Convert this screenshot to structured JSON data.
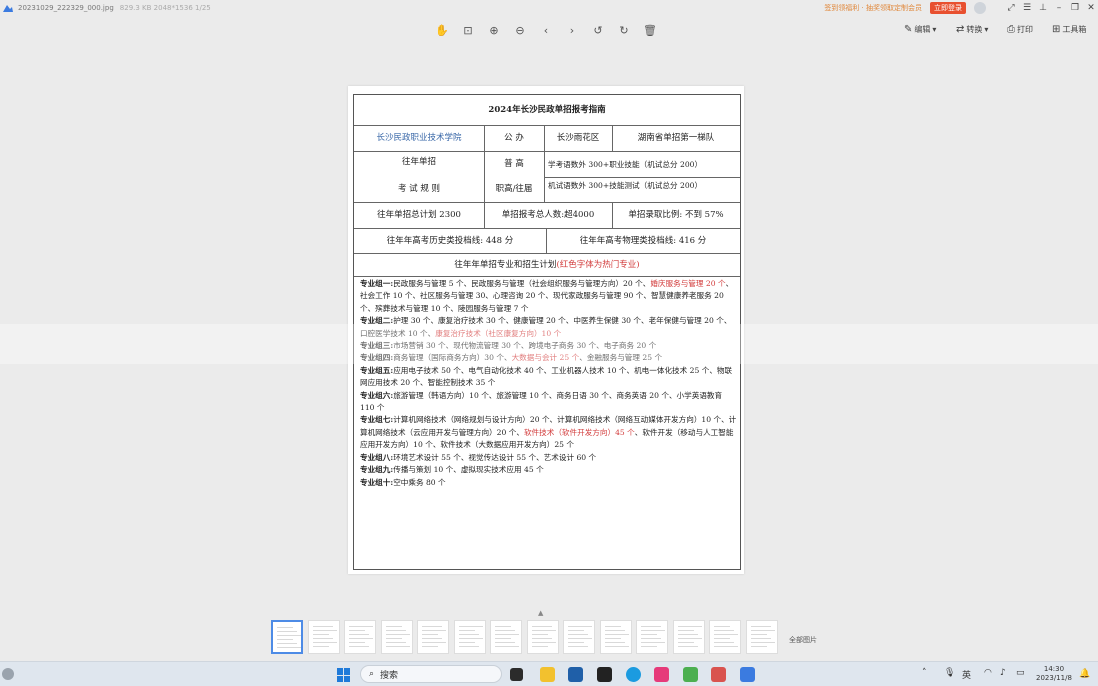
{
  "window": {
    "filename": "20231029_222329_000.jpg",
    "meta": "829.3 KB  2048*1536  1/25",
    "promo": "签到领福利 · 抽奖领取定制会员",
    "login_label": "立即登录"
  },
  "toolbar": {
    "edit_label": "编辑",
    "convert_label": "转换",
    "print_label": "打印",
    "tools_label": "工具箱"
  },
  "doc": {
    "title": "2024年长沙民政单招报考指南",
    "school": "长沙民政职业技术学院",
    "ownership": "公 办",
    "district": "长沙雨花区",
    "tier": "湖南省单招第一梯队",
    "rules_line1": "往年单招",
    "rules_line2": "考 试 规 则",
    "track_general": "普 高",
    "track_general_rule": "学考语数外 300+职业技能（机试总分 200）",
    "track_voc": "职高/往届",
    "track_voc_rule": "机试语数外 300+技能测试（机试总分 200）",
    "plan_total": "往年单招总计划 2300",
    "applicants": "单招报考总人数:超4000",
    "admit_ratio": "单招录取比例: 不到 57%",
    "hist_line": "往年年高考历史类投档线: 448 分",
    "phys_line": "往年年高考物理类投档线: 416 分",
    "plan_header": "往年年单招专业和招生计划",
    "plan_header_note": "(红色字体为热门专业)",
    "groups": [
      {
        "label": "专业组一:",
        "text": "民政服务与管理 5 个、民政服务与管理（社会组织服务与管理方向）20 个、",
        "hot": "婚庆服务与管理 20 个",
        "tail": "、社会工作 10 个、社区服务与管理 30、心理咨询 20 个、现代家政服务与管理 90 个、智慧健康养老服务 20 个、殡葬技术与管理 10 个、陵园服务与管理 7 个"
      },
      {
        "label": "专业组二:",
        "text": "护理 30 个、康复治疗技术 30 个、健康管理 20 个、中医养生保健 30 个、老年保健与管理 20 个、口腔医学技术 10 个、",
        "hot": "康复治疗技术（社区康复方向）10 个",
        "tail": ""
      },
      {
        "label": "专业组三:",
        "text": "市场营销 30 个、现代物流管理 30 个、跨境电子商务 30 个、电子商务 20 个",
        "hot": "",
        "tail": ""
      },
      {
        "label": "专业组四:",
        "text": "商务管理（国际商务方向）30 个、",
        "hot": "大数据与会计 25 个",
        "tail": "、金融服务与管理 25 个"
      },
      {
        "label": "专业组五:",
        "text": "应用电子技术 50 个、电气自动化技术 40 个、工业机器人技术 10 个、机电一体化技术 25 个、物联网应用技术 20 个、智能控制技术 35 个",
        "hot": "",
        "tail": ""
      },
      {
        "label": "专业组六:",
        "text": "旅游管理（韩语方向）10 个、旅游管理 10 个、商务日语 30 个、商务英语 20 个、小学英语教育 110 个",
        "hot": "",
        "tail": ""
      },
      {
        "label": "专业组七:",
        "text": "计算机网络技术（网络规划与设计方向）20 个、计算机网络技术（网络互动媒体开发方向）10 个、计算机网络技术（云应用开发与管理方向）20 个、",
        "hot": "软件技术（软件开发方向）45 个",
        "tail": "、软件开发（移动与人工智能应用开发方向）10 个、软件技术（大数据应用开发方向）25 个"
      },
      {
        "label": "专业组八:",
        "text": "环境艺术设计 55 个、视觉传达设计 55 个、艺术设计 60 个",
        "hot": "",
        "tail": ""
      },
      {
        "label": "专业组九:",
        "text": "传播与策划 10 个、虚拟现实技术应用 45 个",
        "hot": "",
        "tail": ""
      },
      {
        "label": "专业组十:",
        "text": "空中乘务 80 个",
        "hot": "",
        "tail": ""
      }
    ]
  },
  "thumbnails": {
    "all_label": "全部图片",
    "count": 14
  },
  "taskbar": {
    "search_label": "搜索",
    "ime_label": "英",
    "time": "14:30",
    "date": "2023/11/8"
  },
  "colors": {
    "accent_blue": "#3a68a8",
    "hot_red": "#d23a3a",
    "login_orange": "#e8502f"
  }
}
